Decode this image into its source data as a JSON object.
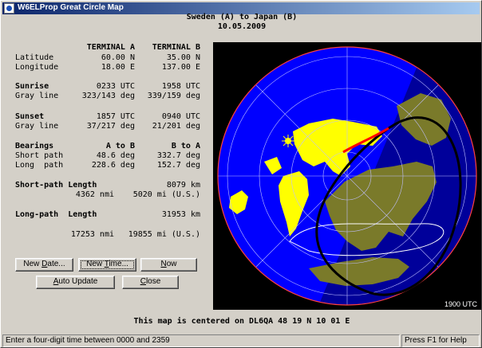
{
  "window": {
    "title": "W6ELProp Great Circle Map"
  },
  "header": {
    "title": "Sweden (A) to Japan (B)",
    "date": "10.05.2009"
  },
  "terminals": {
    "label_a": "TERMINAL A",
    "label_b": "TERMINAL B"
  },
  "latitude": {
    "label": "Latitude",
    "a": "60.00 N",
    "b": "35.00 N"
  },
  "longitude": {
    "label": "Longitude",
    "a": "18.00 E",
    "b": "137.00 E"
  },
  "sunrise": {
    "label": "Sunrise",
    "a": "0233 UTC",
    "b": "1958 UTC"
  },
  "sunrise_grayline": {
    "label": "Gray line",
    "a": "323/143 deg",
    "b": "339/159 deg"
  },
  "sunset": {
    "label": "Sunset",
    "a": "1857 UTC",
    "b": "0940 UTC"
  },
  "sunset_grayline": {
    "label": "Gray line",
    "a": "37/217 deg",
    "b": "21/201 deg"
  },
  "bearings": {
    "label": "Bearings",
    "a_to_b": "A to B",
    "b_to_a": "B to A"
  },
  "short_path": {
    "label": "Short path",
    "a": "48.6 deg",
    "b": "332.7 deg"
  },
  "long_path": {
    "label": "Long  path",
    "a": "228.6 deg",
    "b": "152.7 deg"
  },
  "short_length": {
    "label": "Short-path Length",
    "km": "8079 km",
    "nmi": "4362 nmi",
    "mi": "5020 mi (U.S.)"
  },
  "long_length": {
    "label": "Long-path  Length",
    "km": "31953 km",
    "nmi": "17253 nmi",
    "mi": "19855 mi (U.S.)"
  },
  "buttons": {
    "new_date": {
      "pre": "New ",
      "u": "D",
      "post": "ate..."
    },
    "new_time": {
      "pre": "New ",
      "u": "T",
      "post": "ime..."
    },
    "now": {
      "pre": "",
      "u": "N",
      "post": "ow"
    },
    "auto_update": {
      "pre": "",
      "u": "A",
      "post": "uto Update"
    },
    "close": {
      "pre": "",
      "u": "C",
      "post": "lose"
    }
  },
  "map": {
    "time": "1900 UTC",
    "center_caption": "This map is centered on DL6QA 48 19 N 10 01 E"
  },
  "status": {
    "hint": "Enter a four-digit time between 0000 and 2359",
    "help": "Press F1 for Help"
  },
  "colors": {
    "ocean": "#0000ff",
    "land": "#ffff00",
    "dark_land": "#7a7a2a",
    "night_ocean": "#00009a",
    "short_path": "#ff0000",
    "long_path": "#000000",
    "grid": "#c0c0ff",
    "background": "#000000"
  }
}
